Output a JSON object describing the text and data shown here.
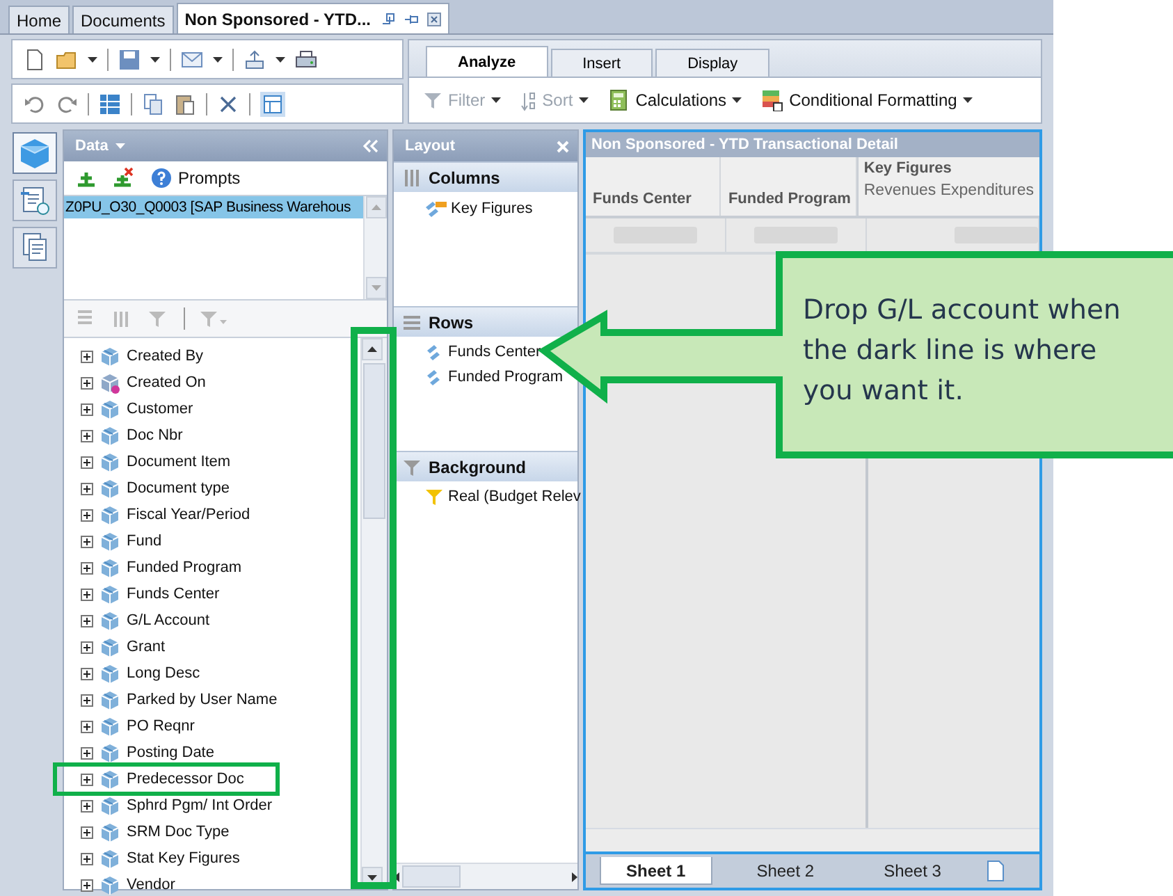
{
  "document_tabs": [
    {
      "label": "Home",
      "selected": false
    },
    {
      "label": "Documents",
      "selected": false
    },
    {
      "label": "Non Sponsored - YTD...",
      "selected": true
    }
  ],
  "ribbon": {
    "tabs": [
      {
        "label": "Analyze",
        "selected": true
      },
      {
        "label": "Insert",
        "selected": false
      },
      {
        "label": "Display",
        "selected": false
      }
    ],
    "tools": [
      {
        "label": "Filter",
        "kind": "filter",
        "disabled": true
      },
      {
        "label": "Sort",
        "kind": "sort",
        "disabled": true
      },
      {
        "label": "Calculations",
        "kind": "calculator",
        "disabled": false
      },
      {
        "label": "Conditional Formatting",
        "kind": "formatting",
        "disabled": false
      }
    ]
  },
  "rail_buttons": [
    {
      "kind": "data",
      "selected": true
    },
    {
      "kind": "navigation",
      "selected": false
    },
    {
      "kind": "pages",
      "selected": false
    }
  ],
  "data_panel": {
    "title": "Data",
    "prompts": "Prompts",
    "sources": [
      {
        "label": "Z0PU_O30_Q0003 [SAP Business Warehous",
        "selected": true
      }
    ],
    "items": [
      {
        "label": "Created By",
        "kind": "dimension"
      },
      {
        "label": "Created On",
        "kind": "time"
      },
      {
        "label": "Customer",
        "kind": "dimension"
      },
      {
        "label": "Doc Nbr",
        "kind": "dimension"
      },
      {
        "label": "Document Item",
        "kind": "dimension"
      },
      {
        "label": "Document type",
        "kind": "dimension"
      },
      {
        "label": "Fiscal Year/Period",
        "kind": "dimension"
      },
      {
        "label": "Fund",
        "kind": "dimension"
      },
      {
        "label": "Funded Program",
        "kind": "dimension"
      },
      {
        "label": "Funds Center",
        "kind": "dimension"
      },
      {
        "label": "G/L Account",
        "kind": "dimension"
      },
      {
        "label": "Grant",
        "kind": "dimension"
      },
      {
        "label": "Long Desc",
        "kind": "dimension"
      },
      {
        "label": "Parked by User Name",
        "kind": "dimension"
      },
      {
        "label": "PO Reqnr",
        "kind": "dimension"
      },
      {
        "label": "Posting Date",
        "kind": "dimension"
      },
      {
        "label": "Predecessor Doc",
        "kind": "dimension"
      },
      {
        "label": "Sphrd Pgm/ Int Order",
        "kind": "dimension"
      },
      {
        "label": "SRM Doc Type",
        "kind": "dimension"
      },
      {
        "label": "Stat Key Figures",
        "kind": "dimension"
      },
      {
        "label": "Vendor",
        "kind": "dimension"
      }
    ]
  },
  "layout_panel": {
    "title": "Layout",
    "sections": [
      {
        "title": "Columns",
        "kind": "columns",
        "items": [
          {
            "label": "Key Figures",
            "kind": "keyfigure"
          }
        ]
      },
      {
        "title": "Rows",
        "kind": "rows",
        "items": [
          {
            "label": "Funds Center",
            "kind": "dimension"
          },
          {
            "label": "Funded Program",
            "kind": "dimension"
          }
        ]
      },
      {
        "title": "Background",
        "kind": "filter",
        "items": [
          {
            "label": "Real (Budget Relev",
            "kind": "filter"
          }
        ]
      }
    ]
  },
  "crosstab": {
    "title": "Non Sponsored - YTD Transactional Detail",
    "columns": [
      {
        "label": "Funds Center"
      },
      {
        "label": "Funded Program"
      }
    ],
    "key_figures": {
      "title": "Key Figures",
      "measures": "Revenues Expenditures"
    }
  },
  "sheets": [
    {
      "label": "Sheet 1",
      "selected": true
    },
    {
      "label": "Sheet 2",
      "selected": false
    },
    {
      "label": "Sheet 3",
      "selected": false
    }
  ],
  "callout": {
    "text": "Drop G/L account when the dark line is where you want it."
  }
}
